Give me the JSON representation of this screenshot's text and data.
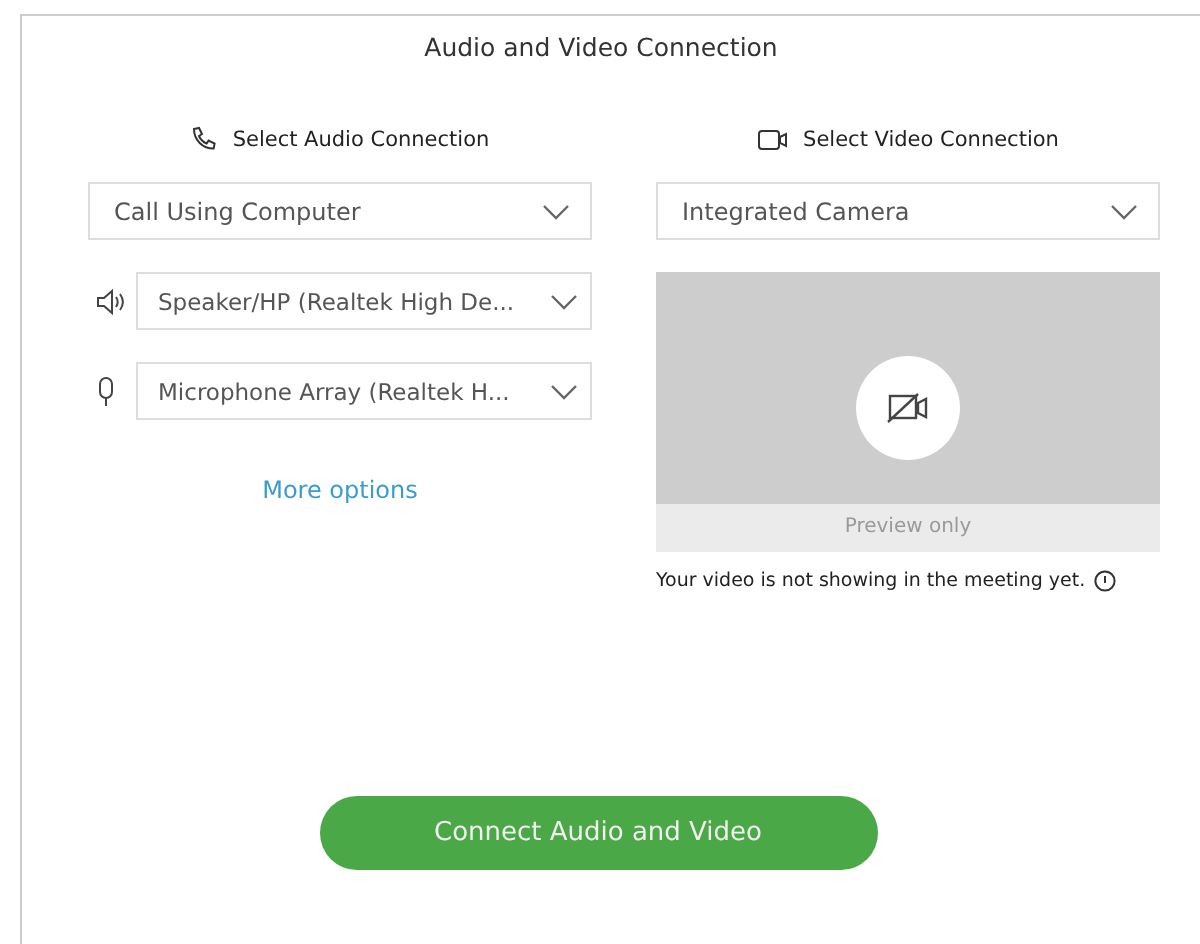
{
  "window": {
    "title": "Audio and Video Connection"
  },
  "audio": {
    "heading": "Select Audio Connection",
    "connection": "Call Using Computer",
    "devices": [
      {
        "kind": "speaker",
        "value": "Speaker/HP (Realtek High De..."
      },
      {
        "kind": "microphone",
        "value": "Microphone Array (Realtek H..."
      }
    ],
    "link": "More options"
  },
  "video": {
    "heading": "Select Video Connection",
    "camera": "Integrated Camera",
    "preview_label": "Preview only",
    "notice": "Your video is not showing in the meeting yet."
  },
  "button": "Connect Audio and Video"
}
